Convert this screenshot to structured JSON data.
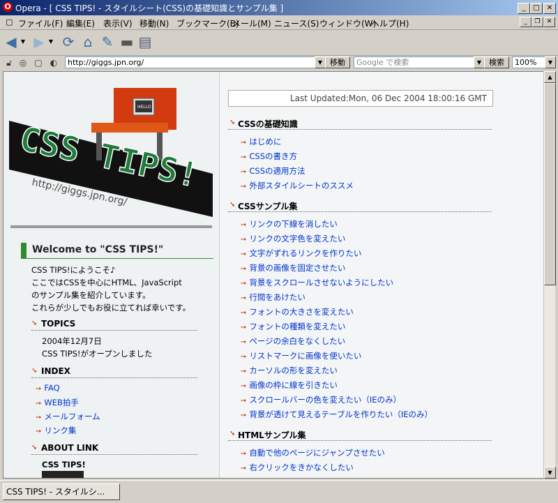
{
  "window": {
    "title": "Opera - [ CSS TIPS! - スタイルシート(CSS)の基礎知識とサンプル集 ]",
    "logo_letter": "O"
  },
  "menu": [
    "ファイル(F)",
    "編集(E)",
    "表示(V)",
    "移動(N)",
    "ブックマーク(B)",
    "メール(M)",
    "ニュース(S)",
    "ウィンドウ(W)",
    "ヘルプ(H)"
  ],
  "addressbar": {
    "url": "http://giggs.jpn.org/",
    "go_label": "移動",
    "search_placeholder": "Google で検索",
    "search_label": "検索",
    "zoom": "100%"
  },
  "left": {
    "logo_text": "CSS TIPS!",
    "logo_url": "http://giggs.jpn.org/",
    "monitor_text": "HELLO",
    "welcome_title": "Welcome to \"CSS TIPS!\"",
    "intro": [
      "CSS TIPS!にようこそ♪",
      "ここではCSSを中心にHTML、JavaScript",
      "のサンプル集を紹介しています。",
      "これらが少しでもお役に立てれば幸いです。"
    ],
    "topics_title": "TOPICS",
    "topics_date": "2004年12月7日",
    "topics_text": "CSS TIPS!がオープンしました",
    "index_title": "INDEX",
    "index_links": [
      "FAQ",
      "WEB拍手",
      "メールフォーム",
      "リンク集"
    ],
    "about_title": "ABOUT LINK",
    "about_site": "CSS TIPS!"
  },
  "right": {
    "last_updated": "Last Updated:Mon, 06 Dec 2004 18:00:16 GMT",
    "sections": [
      {
        "title": "CSSの基礎知識",
        "links": [
          "はじめに",
          "CSSの書き方",
          "CSSの適用方法",
          "外部スタイルシートのススメ"
        ]
      },
      {
        "title": "CSSサンプル集",
        "links": [
          "リンクの下線を消したい",
          "リンクの文字色を変えたい",
          "文字がずれるリンクを作りたい",
          "背景の画像を固定させたい",
          "背景をスクロールさせないようにしたい",
          "行間をあけたい",
          "フォントの大きさを変えたい",
          "フォントの種類を変えたい",
          "ページの余白をなくしたい",
          "リストマークに画像を使いたい",
          "カーソルの形を変えたい",
          "画像の枠に線を引きたい",
          "スクロールバーの色を変えたい（IEのみ）",
          "背景が透けて見えるテーブルを作りたい（IEのみ）"
        ]
      },
      {
        "title": "HTMLサンプル集",
        "links": [
          "自動で他のページにジャンプさせたい",
          "右クリックをきかなくしたい"
        ]
      }
    ]
  },
  "status": {
    "tab_label": "CSS TIPS! - スタイルシ..."
  }
}
